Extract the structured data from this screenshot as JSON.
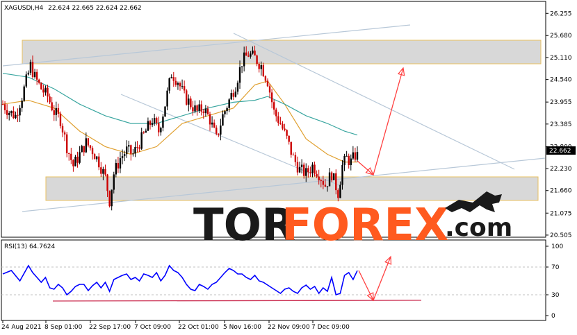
{
  "header": {
    "symbol": "XAGUSDi,H4",
    "ohlc": "22.624 22.665 22.624 22.662",
    "rsi_label": "RSI(13) 64.7624"
  },
  "logo": {
    "part1": "TOR",
    "part2": "FOREX",
    "part3": ".com"
  },
  "colors": {
    "up": "#000000",
    "down": "#cc0000",
    "ma_fast": "#e0a030",
    "ma_slow": "#3aa6a0",
    "rsi": "#0000ff",
    "zone_fill": "#d8d8d8",
    "zone_border": "#e8c060",
    "channel": "#b8c8d8",
    "arrow": "#ff4040",
    "logo_dark": "#1a1a1a",
    "logo_orange": "#ff5a1f"
  },
  "chart_data": [
    {
      "type": "candlestick",
      "title": "XAGUSDi,H4",
      "current_price": "22.662",
      "y_ticks": [
        "26.255",
        "25.680",
        "25.110",
        "24.540",
        "23.955",
        "23.385",
        "22.800",
        "22.230",
        "21.660",
        "21.075",
        "20.505"
      ],
      "x_ticks": [
        "24 Aug 2021",
        "8 Sep 01:00",
        "22 Sep 17:00",
        "7 Oct 09:00",
        "22 Oct 01:00",
        "5 Nov 16:00",
        "22 Nov 09:00",
        "7 Dec 09:00"
      ],
      "ylim": [
        20.45,
        26.35
      ],
      "close_path": [
        [
          0,
          23.9
        ],
        [
          3,
          23.7
        ],
        [
          6,
          23.6
        ],
        [
          9,
          24.1
        ],
        [
          11,
          24.5
        ],
        [
          13,
          24.9
        ],
        [
          15,
          24.6
        ],
        [
          18,
          24.3
        ],
        [
          21,
          24.1
        ],
        [
          24,
          23.7
        ],
        [
          27,
          23.5
        ],
        [
          30,
          22.8
        ],
        [
          33,
          22.3
        ],
        [
          36,
          22.6
        ],
        [
          39,
          22.9
        ],
        [
          42,
          22.7
        ],
        [
          45,
          22.4
        ],
        [
          48,
          22.0
        ],
        [
          50,
          21.4
        ],
        [
          52,
          22.1
        ],
        [
          55,
          22.5
        ],
        [
          58,
          22.7
        ],
        [
          61,
          22.6
        ],
        [
          64,
          22.9
        ],
        [
          67,
          23.2
        ],
        [
          70,
          23.5
        ],
        [
          73,
          23.2
        ],
        [
          76,
          23.9
        ],
        [
          79,
          24.7
        ],
        [
          82,
          24.5
        ],
        [
          85,
          24.1
        ],
        [
          88,
          23.9
        ],
        [
          91,
          23.7
        ],
        [
          94,
          23.8
        ],
        [
          97,
          23.5
        ],
        [
          100,
          23.0
        ],
        [
          103,
          23.6
        ],
        [
          106,
          24.0
        ],
        [
          109,
          24.4
        ],
        [
          112,
          25.0
        ],
        [
          115,
          25.2
        ],
        [
          118,
          25.1
        ],
        [
          121,
          24.9
        ],
        [
          124,
          24.5
        ],
        [
          127,
          23.7
        ],
        [
          130,
          23.4
        ],
        [
          133,
          23.0
        ],
        [
          136,
          22.5
        ],
        [
          139,
          22.2
        ],
        [
          142,
          22.1
        ],
        [
          145,
          22.3
        ],
        [
          148,
          22.1
        ],
        [
          151,
          21.8
        ],
        [
          154,
          22.1
        ],
        [
          157,
          21.6
        ],
        [
          159,
          22.3
        ],
        [
          161,
          22.5
        ],
        [
          163,
          22.4
        ],
        [
          166,
          22.662
        ]
      ],
      "series": [
        {
          "name": "",
          "kind": "ma_fast",
          "points": [
            [
              0,
              23.9
            ],
            [
              12,
              24.0
            ],
            [
              24,
              23.8
            ],
            [
              36,
              23.2
            ],
            [
              48,
              22.8
            ],
            [
              60,
              22.6
            ],
            [
              72,
              22.8
            ],
            [
              84,
              23.4
            ],
            [
              96,
              23.6
            ],
            [
              108,
              23.8
            ],
            [
              118,
              24.4
            ],
            [
              124,
              24.5
            ],
            [
              132,
              23.9
            ],
            [
              142,
              23.0
            ],
            [
              152,
              22.6
            ],
            [
              160,
              22.4
            ],
            [
              166,
              22.4
            ]
          ]
        },
        {
          "name": "",
          "kind": "ma_slow",
          "points": [
            [
              0,
              24.7
            ],
            [
              12,
              24.6
            ],
            [
              24,
              24.3
            ],
            [
              36,
              23.9
            ],
            [
              48,
              23.6
            ],
            [
              60,
              23.4
            ],
            [
              72,
              23.4
            ],
            [
              84,
              23.6
            ],
            [
              96,
              23.8
            ],
            [
              108,
              23.95
            ],
            [
              118,
              24.0
            ],
            [
              124,
              24.1
            ],
            [
              132,
              23.9
            ],
            [
              142,
              23.6
            ],
            [
              152,
              23.4
            ],
            [
              160,
              23.2
            ],
            [
              166,
              23.1
            ]
          ]
        }
      ]
    },
    {
      "type": "line",
      "title": "RSI(13) 64.7624",
      "y_ticks": [
        "100",
        "70",
        "30",
        "0"
      ],
      "ylim": [
        0,
        100
      ],
      "points": [
        [
          0,
          60
        ],
        [
          4,
          65
        ],
        [
          8,
          50
        ],
        [
          12,
          72
        ],
        [
          14,
          62
        ],
        [
          16,
          55
        ],
        [
          18,
          48
        ],
        [
          20,
          55
        ],
        [
          22,
          40
        ],
        [
          24,
          38
        ],
        [
          26,
          45
        ],
        [
          28,
          40
        ],
        [
          30,
          30
        ],
        [
          32,
          35
        ],
        [
          34,
          42
        ],
        [
          36,
          45
        ],
        [
          38,
          45
        ],
        [
          40,
          36
        ],
        [
          42,
          43
        ],
        [
          44,
          48
        ],
        [
          46,
          40
        ],
        [
          48,
          48
        ],
        [
          50,
          35
        ],
        [
          52,
          52
        ],
        [
          54,
          55
        ],
        [
          56,
          58
        ],
        [
          58,
          60
        ],
        [
          60,
          52
        ],
        [
          62,
          55
        ],
        [
          64,
          50
        ],
        [
          66,
          60
        ],
        [
          68,
          58
        ],
        [
          70,
          55
        ],
        [
          72,
          62
        ],
        [
          74,
          50
        ],
        [
          76,
          58
        ],
        [
          78,
          72
        ],
        [
          80,
          65
        ],
        [
          82,
          62
        ],
        [
          84,
          55
        ],
        [
          86,
          45
        ],
        [
          88,
          38
        ],
        [
          90,
          36
        ],
        [
          92,
          45
        ],
        [
          94,
          42
        ],
        [
          96,
          38
        ],
        [
          98,
          45
        ],
        [
          100,
          48
        ],
        [
          102,
          55
        ],
        [
          104,
          62
        ],
        [
          106,
          68
        ],
        [
          108,
          65
        ],
        [
          110,
          60
        ],
        [
          112,
          60
        ],
        [
          114,
          55
        ],
        [
          116,
          52
        ],
        [
          118,
          58
        ],
        [
          120,
          50
        ],
        [
          122,
          48
        ],
        [
          124,
          44
        ],
        [
          126,
          40
        ],
        [
          128,
          36
        ],
        [
          130,
          32
        ],
        [
          132,
          38
        ],
        [
          134,
          40
        ],
        [
          136,
          35
        ],
        [
          138,
          32
        ],
        [
          140,
          40
        ],
        [
          142,
          44
        ],
        [
          144,
          38
        ],
        [
          146,
          42
        ],
        [
          148,
          32
        ],
        [
          150,
          40
        ],
        [
          152,
          35
        ],
        [
          154,
          55
        ],
        [
          156,
          30
        ],
        [
          158,
          32
        ],
        [
          160,
          58
        ],
        [
          162,
          62
        ],
        [
          164,
          52
        ],
        [
          166,
          64.76
        ]
      ],
      "hlines": [
        70,
        30
      ]
    }
  ]
}
